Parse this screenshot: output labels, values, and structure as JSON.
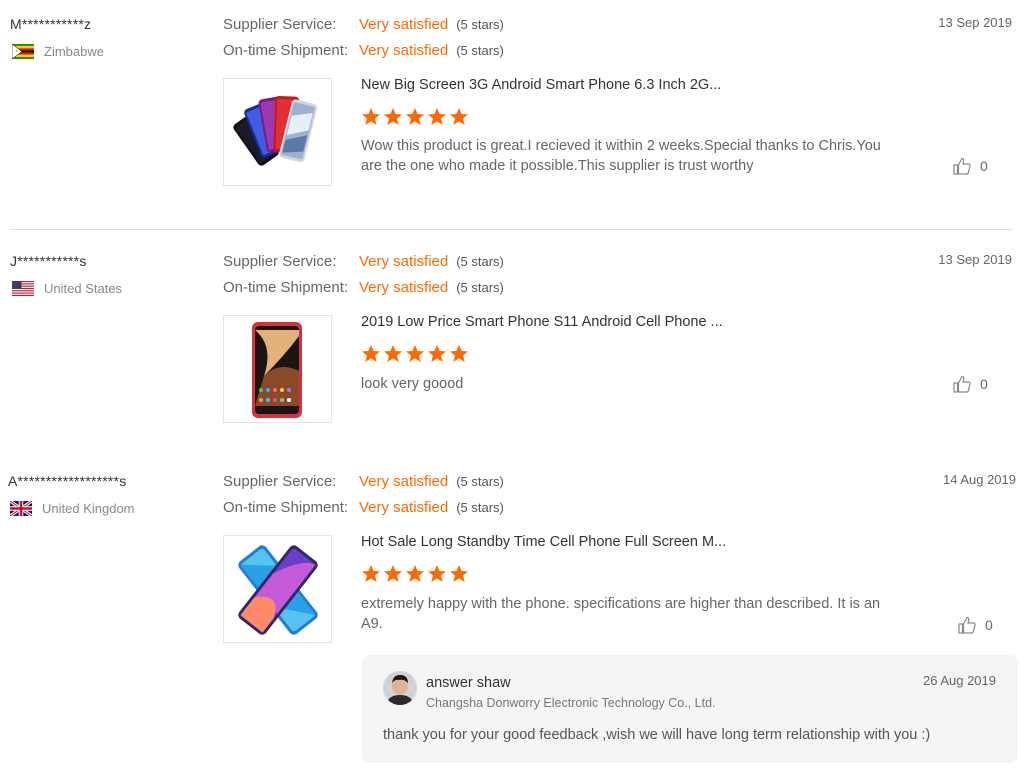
{
  "labels": {
    "supplier_service": "Supplier Service:",
    "ontime_shipment": "On-time Shipment:"
  },
  "colors": {
    "accent": "#ff6a00",
    "divider": "#dcdcdc"
  },
  "reviews": [
    {
      "buyer": "M***********z",
      "country": "Zimbabwe",
      "flag_icon": "zimbabwe-flag-icon",
      "supplier_value": "Very satisfied",
      "supplier_stars": "(5 stars)",
      "shipment_value": "Very satisfied",
      "shipment_stars": "(5 stars)",
      "date": "13 Sep 2019",
      "product_title": "New Big Screen 3G Android Smart Phone 6.3 Inch 2G...",
      "rating": 5,
      "text": "Wow this product is great.I recieved it within 2 weeks.Special thanks to Chris.You are the one who made it possible.This supplier is trust worthy",
      "likes": "0"
    },
    {
      "buyer": "J***********s",
      "country": "United States",
      "flag_icon": "united-states-flag-icon",
      "supplier_value": "Very satisfied",
      "supplier_stars": "(5 stars)",
      "shipment_value": "Very satisfied",
      "shipment_stars": "(5 stars)",
      "date": "13 Sep 2019",
      "product_title": "2019 Low Price Smart Phone S11 Android Cell Phone ...",
      "rating": 5,
      "text": "look very goood",
      "likes": "0"
    },
    {
      "buyer": "A******************s",
      "country": "United Kingdom",
      "flag_icon": "united-kingdom-flag-icon",
      "supplier_value": "Very satisfied",
      "supplier_stars": "(5 stars)",
      "shipment_value": "Very satisfied",
      "shipment_stars": "(5 stars)",
      "date": "14 Aug 2019",
      "product_title": "Hot Sale Long Standby Time Cell Phone Full Screen M...",
      "rating": 5,
      "text": "extremely happy with the phone. specifications are higher than described. It is an A9.",
      "likes": "0",
      "reply": {
        "name": "answer shaw",
        "company": "Changsha Donworry Electronic Technology Co., Ltd.",
        "date": "26 Aug 2019",
        "text": "thank you for your good feedback ,wish we will have long term relationship with you :)"
      }
    }
  ]
}
